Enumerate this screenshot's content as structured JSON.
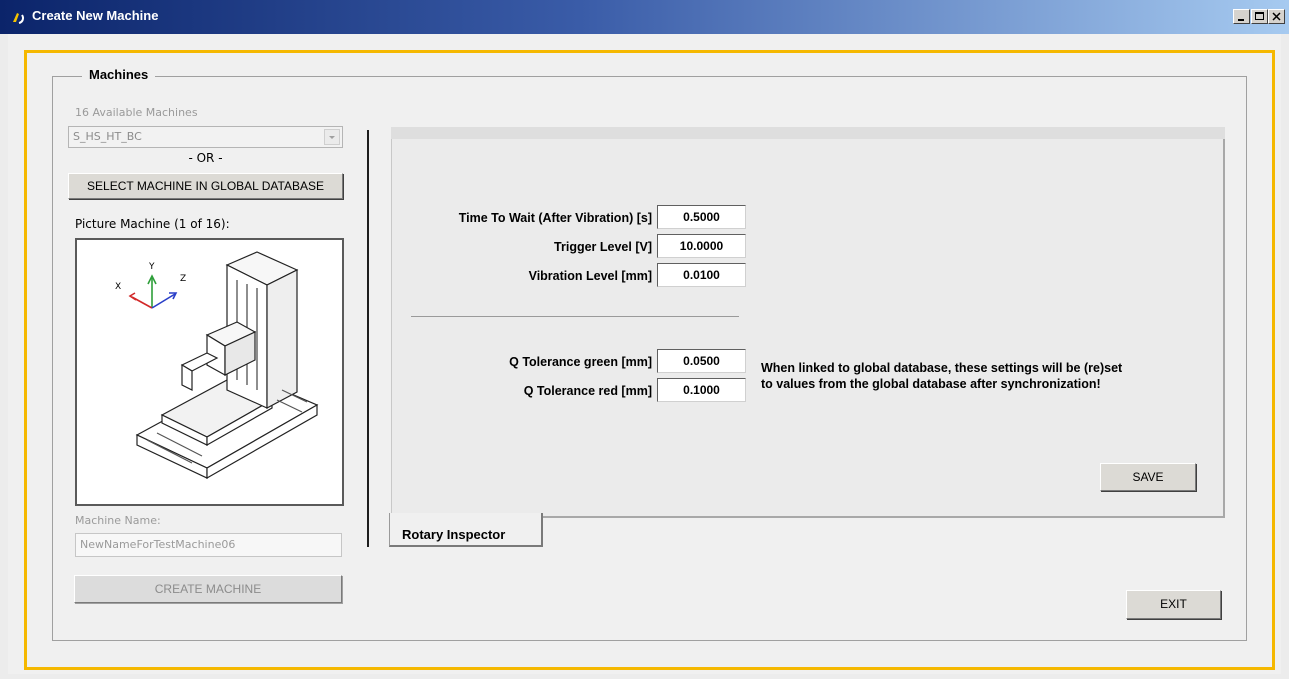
{
  "window": {
    "title": "Create New Machine",
    "controls": [
      "minimize-icon",
      "maximize-icon",
      "close-icon"
    ]
  },
  "machines": {
    "group_title": "Machines",
    "available_label": "16 Available Machines",
    "selected_machine": "S_HS_HT_BC",
    "or_label": "- OR -",
    "select_global_button": "SELECT MACHINE IN GLOBAL DATABASE",
    "picture_label": "Picture Machine (1 of 16):",
    "axes": {
      "x": "X",
      "y": "Y",
      "z": "Z"
    },
    "name_label": "Machine Name:",
    "name_value": "NewNameForTestMachine06",
    "create_button": "CREATE MACHINE"
  },
  "settings": {
    "time_to_wait": {
      "label": "Time To Wait (After Vibration) [s]",
      "value": "0.5000"
    },
    "trigger_level": {
      "label": "Trigger Level [V]",
      "value": "10.0000"
    },
    "vibration_level": {
      "label": "Vibration Level [mm]",
      "value": "0.0100"
    },
    "q_tol_green": {
      "label": "Q Tolerance green [mm]",
      "value": "0.0500"
    },
    "q_tol_red": {
      "label": "Q Tolerance red [mm]",
      "value": "0.1000"
    },
    "note_line1": "When linked to global database, these settings will be (re)set",
    "note_line2": "to values from the global database after synchronization!",
    "save_button": "SAVE"
  },
  "tabs": [
    {
      "label": "Rotary Inspector",
      "selected": true
    }
  ],
  "exit_button": "EXIT",
  "colors": {
    "frame_accent": "#f5b800",
    "title_gradient_start": "#0b246a",
    "title_gradient_end": "#a6caf0"
  }
}
